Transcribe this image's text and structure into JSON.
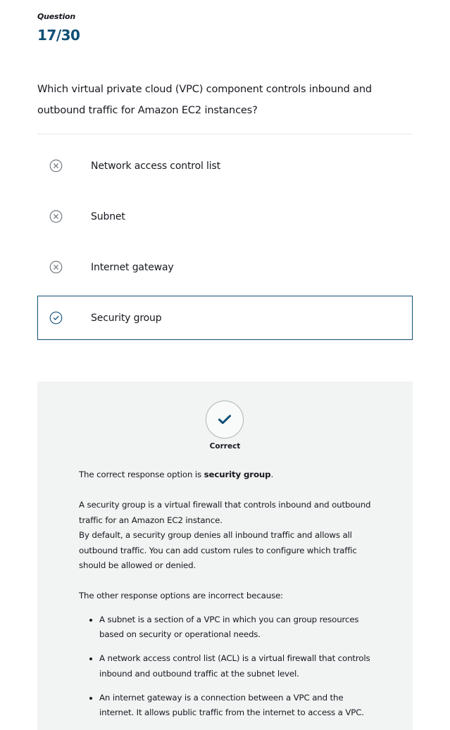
{
  "question": {
    "label": "Question",
    "counter": "17/30",
    "text": "Which virtual private cloud (VPC) component controls inbound and outbound traffic for Amazon EC2 instances?"
  },
  "options": [
    {
      "label": "Network access control list",
      "icon": "x-circle-icon",
      "state": "incorrect"
    },
    {
      "label": "Subnet",
      "icon": "x-circle-icon",
      "state": "incorrect"
    },
    {
      "label": "Internet gateway",
      "icon": "x-circle-icon",
      "state": "incorrect"
    },
    {
      "label": "Security group",
      "icon": "check-circle-icon",
      "state": "selected-correct"
    }
  ],
  "feedback": {
    "status": "Correct",
    "status_icon": "checkmark-icon",
    "intro_prefix": "The correct response option is ",
    "intro_answer": "security group",
    "intro_suffix": ".",
    "explanation_1": "A security group is a virtual firewall that controls inbound and outbound traffic for an Amazon EC2 instance.",
    "explanation_2": "By default, a security group denies all inbound traffic and allows all outbound traffic. You can add custom rules to configure which traffic should be allowed or denied.",
    "other_intro": "The other response options are incorrect because:",
    "reasons": [
      "A subnet is a section of a VPC in which you can group resources based on security or operational needs.",
      "A network access control list (ACL) is a virtual firewall that controls inbound and outbound traffic at the subnet level.",
      "An internet gateway is a connection between a VPC and the internet. It allows public traffic from the internet to access a VPC."
    ]
  },
  "colors": {
    "accent": "#0f4f75",
    "icon_gray": "#687078",
    "feedback_bg": "#f2f3f3"
  }
}
